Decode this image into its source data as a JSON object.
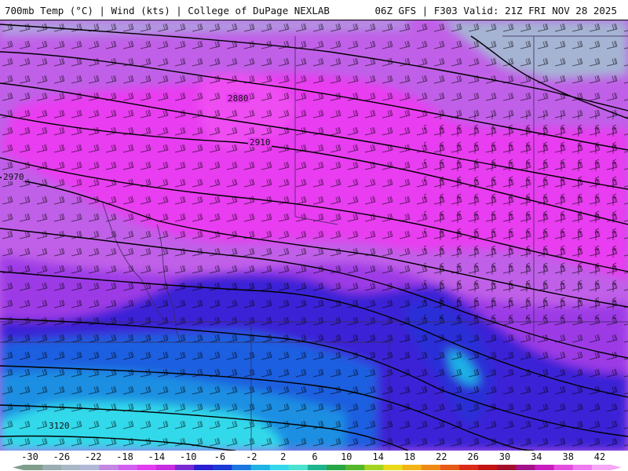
{
  "header": {
    "left_text": "700mb Temp (°C) | Wind (kts) | College of DuPage NEXLAB",
    "right_text": "06Z GFS | F303 Valid: 21Z FRI NOV 28 2025"
  },
  "map": {
    "contour_labels": [
      {
        "label": "2880"
      },
      {
        "label": "2910"
      },
      {
        "label": "2970"
      },
      {
        "label": "3120"
      }
    ]
  },
  "colorbar": {
    "labels": [
      "-30",
      "-26",
      "-22",
      "-18",
      "-14",
      "-10",
      "-6",
      "-2",
      "2",
      "6",
      "10",
      "14",
      "18",
      "22",
      "26",
      "30",
      "34",
      "38",
      "42"
    ],
    "colors": [
      "#7f9e8c",
      "#9aaeb1",
      "#aab8c6",
      "#b3b8d6",
      "#c488e4",
      "#d35ff0",
      "#e13cf0",
      "#c82de2",
      "#7a2ad3",
      "#2b1ed3",
      "#1c3ad6",
      "#1b78e0",
      "#1fb3e6",
      "#33d9ea",
      "#4ce2d0",
      "#1fb58c",
      "#27a646",
      "#54b82a",
      "#a5d420",
      "#eadb18",
      "#f2b417",
      "#f08a17",
      "#e85a18",
      "#dc2c19",
      "#c41414",
      "#a40f2c",
      "#a4128a",
      "#c91ec0",
      "#e54ee0",
      "#f07bf0",
      "#f5a6f5"
    ]
  },
  "colors": {
    "cold_purple": "#c060e8",
    "magenta": "#e83cf0",
    "violet": "#9c3ae6",
    "deep_blue": "#2b1ed3",
    "blue": "#1c5ee0",
    "cyan": "#1fbde6"
  }
}
